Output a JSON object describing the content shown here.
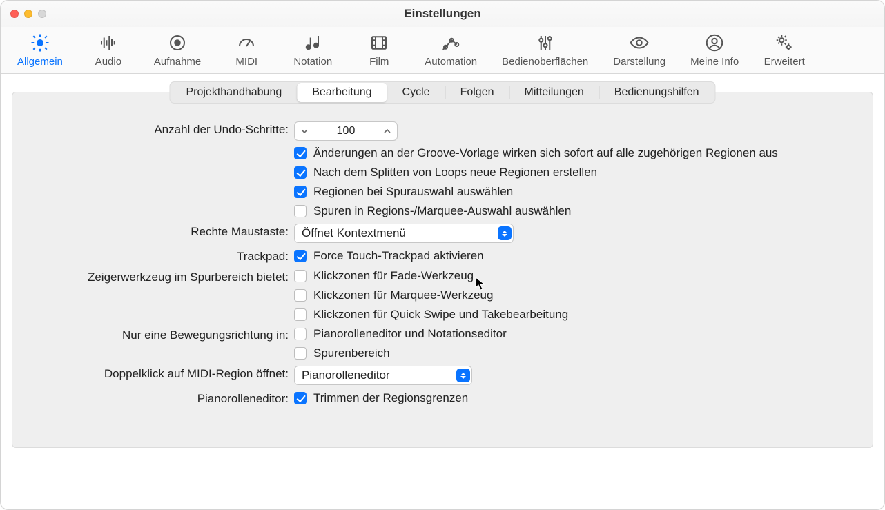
{
  "window": {
    "title": "Einstellungen"
  },
  "toolbar": {
    "items": [
      {
        "label": "Allgemein",
        "icon": "gear-icon",
        "selected": true
      },
      {
        "label": "Audio",
        "icon": "waveform-icon",
        "selected": false
      },
      {
        "label": "Aufnahme",
        "icon": "record-icon",
        "selected": false
      },
      {
        "label": "MIDI",
        "icon": "gauge-icon",
        "selected": false
      },
      {
        "label": "Notation",
        "icon": "notes-icon",
        "selected": false
      },
      {
        "label": "Film",
        "icon": "film-icon",
        "selected": false
      },
      {
        "label": "Automation",
        "icon": "automation-icon",
        "selected": false
      },
      {
        "label": "Bedienoberflächen",
        "icon": "sliders-icon",
        "selected": false
      },
      {
        "label": "Darstellung",
        "icon": "eye-icon",
        "selected": false
      },
      {
        "label": "Meine Info",
        "icon": "user-icon",
        "selected": false
      },
      {
        "label": "Erweitert",
        "icon": "gears-icon",
        "selected": false
      }
    ]
  },
  "tabs": [
    {
      "label": "Projekthandhabung",
      "active": false
    },
    {
      "label": "Bearbeitung",
      "active": true
    },
    {
      "label": "Cycle",
      "active": false
    },
    {
      "label": "Folgen",
      "active": false
    },
    {
      "label": "Mitteilungen",
      "active": false
    },
    {
      "label": "Bedienungshilfen",
      "active": false
    }
  ],
  "form": {
    "undo_label": "Anzahl der Undo-Schritte:",
    "undo_value": "100",
    "undo_checks": [
      {
        "checked": true,
        "text": "Änderungen an der Groove-Vorlage wirken sich sofort auf alle zugehörigen Regionen aus"
      },
      {
        "checked": true,
        "text": "Nach dem Splitten von Loops neue Regionen erstellen"
      },
      {
        "checked": true,
        "text": "Regionen bei Spurauswahl auswählen"
      },
      {
        "checked": false,
        "text": "Spuren in Regions-/Marquee-Auswahl auswählen"
      }
    ],
    "rmb_label": "Rechte Maustaste:",
    "rmb_value": "Öffnet Kontextmenü",
    "trackpad_label": "Trackpad:",
    "trackpad_check": {
      "checked": true,
      "text": "Force Touch-Trackpad aktivieren"
    },
    "pointer_label": "Zeigerwerkzeug im Spurbereich bietet:",
    "pointer_checks": [
      {
        "checked": false,
        "text": "Klickzonen für Fade-Werkzeug"
      },
      {
        "checked": false,
        "text": "Klickzonen für Marquee-Werkzeug"
      },
      {
        "checked": false,
        "text": "Klickzonen für Quick Swipe und Takebearbeitung"
      }
    ],
    "singledir_label": "Nur eine Bewegungsrichtung in:",
    "singledir_checks": [
      {
        "checked": false,
        "text": "Pianorolleneditor und Notationseditor"
      },
      {
        "checked": false,
        "text": "Spurenbereich"
      }
    ],
    "midi_dbl_label": "Doppelklick auf MIDI-Region öffnet:",
    "midi_dbl_value": "Pianorolleneditor",
    "pianoroll_label": "Pianorolleneditor:",
    "pianoroll_check": {
      "checked": true,
      "text": "Trimmen der Regionsgrenzen"
    }
  }
}
